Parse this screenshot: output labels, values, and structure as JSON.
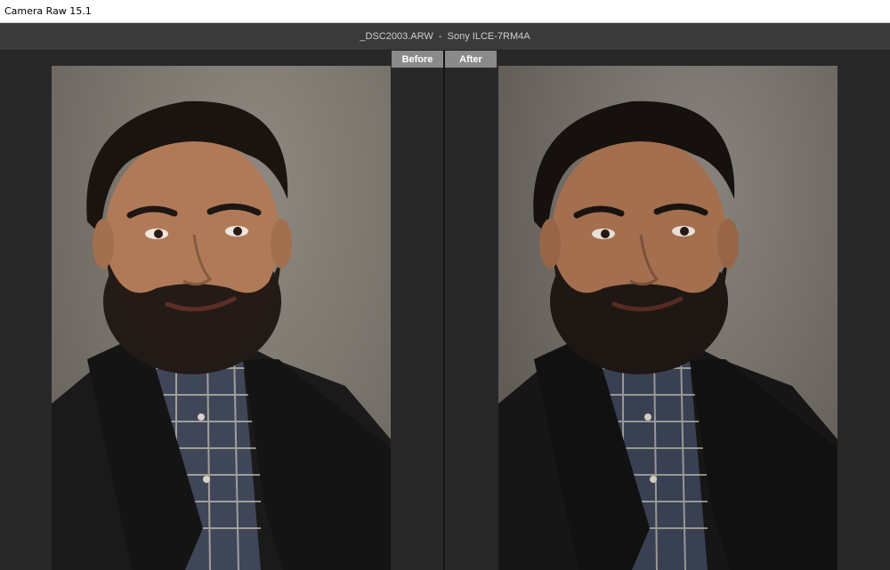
{
  "window": {
    "title": "Camera Raw 15.1"
  },
  "file_info": {
    "label": "_DSC2003.ARW  -  Sony ILCE-7RM4A"
  },
  "views": {
    "before_label": "Before",
    "after_label": "After"
  },
  "colors": {
    "titlebar": "#ffffff",
    "filebar": "#3a3a3a",
    "workspace": "#282828",
    "tab": "#8a8a8a",
    "divider": "#141414"
  }
}
